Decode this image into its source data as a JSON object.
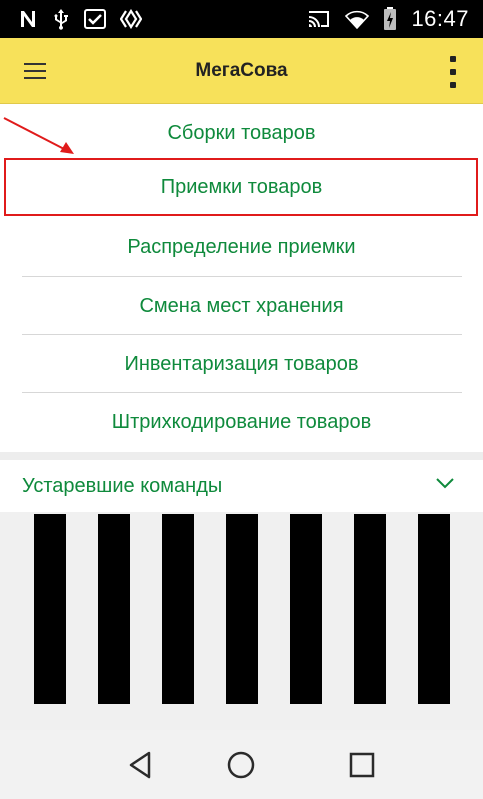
{
  "status_bar": {
    "time": "16:47",
    "icons": [
      "notification-n-icon",
      "usb-icon",
      "checkbox-icon",
      "diamond-icon",
      "cast-icon",
      "wifi-icon",
      "battery-charging-icon"
    ]
  },
  "app_bar": {
    "title": "МегаСова",
    "menu_icon": "hamburger-icon",
    "more_icon": "more-vertical-icon"
  },
  "menu": {
    "items": [
      {
        "label": "Сборки товаров"
      },
      {
        "label": "Приемки товаров"
      },
      {
        "label": "Распределение приемки"
      },
      {
        "label": "Смена мест хранения"
      },
      {
        "label": "Инвентаризация товаров"
      },
      {
        "label": "Штрихкодирование товаров"
      }
    ],
    "highlighted_index": 1
  },
  "obsolete_section": {
    "title": "Устаревшие команды",
    "chevron_icon": "chevron-down-icon"
  },
  "colors": {
    "app_bar": "#f7e15a",
    "menu_text": "#0f8a3c",
    "highlight": "#e01b1b"
  },
  "nav_bar": {
    "buttons": [
      "back-icon",
      "home-icon",
      "recents-icon"
    ]
  }
}
